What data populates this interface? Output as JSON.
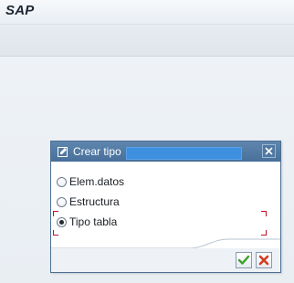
{
  "app": {
    "title": "SAP"
  },
  "dialog": {
    "title": "Crear tipo",
    "options": [
      {
        "label": "Elem.datos",
        "selected": false
      },
      {
        "label": "Estructura",
        "selected": false
      },
      {
        "label": "Tipo tabla",
        "selected": true
      }
    ],
    "buttons": {
      "confirm_icon": "checkmark-icon",
      "cancel_icon": "cancel-x-icon"
    }
  },
  "colors": {
    "titlebar": "#47709a",
    "confirm_green": "#3aa12a",
    "cancel_red": "#d63a1e",
    "focus_red": "#c0102a"
  }
}
